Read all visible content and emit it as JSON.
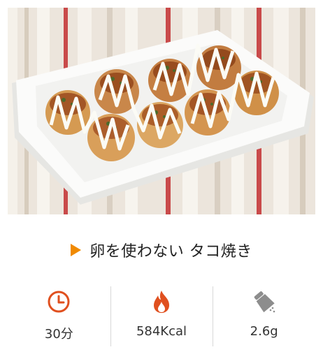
{
  "recipe": {
    "title": "卵を使わない タコ焼き",
    "photo_icon": "takoyaki-photo"
  },
  "stats": [
    {
      "icon": "clock-icon",
      "value": "30分"
    },
    {
      "icon": "fire-icon",
      "value": "584Kcal"
    },
    {
      "icon": "salt-shaker-icon",
      "value": "2.6g"
    }
  ],
  "colors": {
    "accent": "#f08a00",
    "icon_red": "#e0501f",
    "divider": "#d8d8d8"
  }
}
